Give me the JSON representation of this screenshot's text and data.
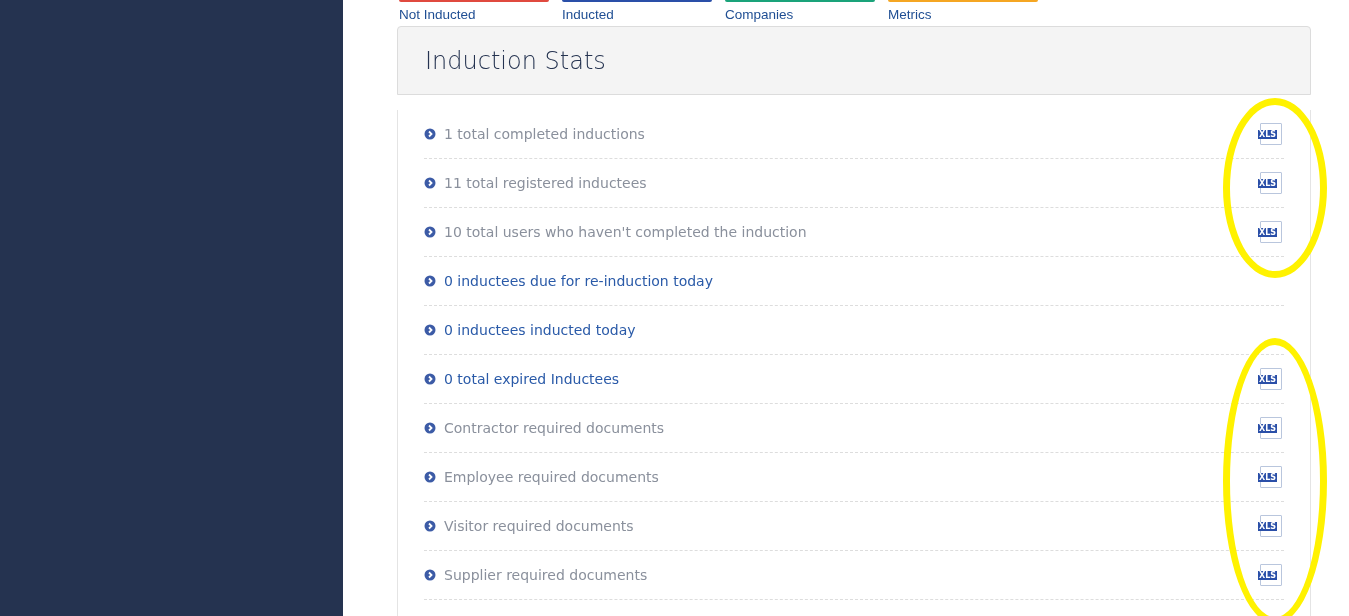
{
  "tabs": [
    {
      "label": "Not Inducted",
      "color": "#e04a3f"
    },
    {
      "label": "Inducted",
      "color": "#2a4fa8"
    },
    {
      "label": "Companies",
      "color": "#1aa37a"
    },
    {
      "label": "Metrics",
      "color": "#f5a623"
    }
  ],
  "panel": {
    "title": "Induction Stats"
  },
  "stats": [
    {
      "text": "1 total completed inductions",
      "kind": "plain",
      "export_label": "XLS"
    },
    {
      "text": "11 total registered inductees",
      "kind": "plain",
      "export_label": "XLS"
    },
    {
      "text": "10 total users who haven't completed the induction",
      "kind": "plain",
      "export_label": "XLS"
    },
    {
      "text": "0 inductees due for re-induction today",
      "kind": "link"
    },
    {
      "text": "0 inductees inducted today",
      "kind": "link"
    },
    {
      "text": "0 total expired Inductees",
      "kind": "link",
      "export_label": "XLS"
    },
    {
      "text": "Contractor required documents",
      "kind": "plain",
      "export_label": "XLS"
    },
    {
      "text": "Employee required documents",
      "kind": "plain",
      "export_label": "XLS"
    },
    {
      "text": "Visitor required documents",
      "kind": "plain",
      "export_label": "XLS"
    },
    {
      "text": "Supplier required documents",
      "kind": "plain",
      "export_label": "XLS"
    }
  ]
}
